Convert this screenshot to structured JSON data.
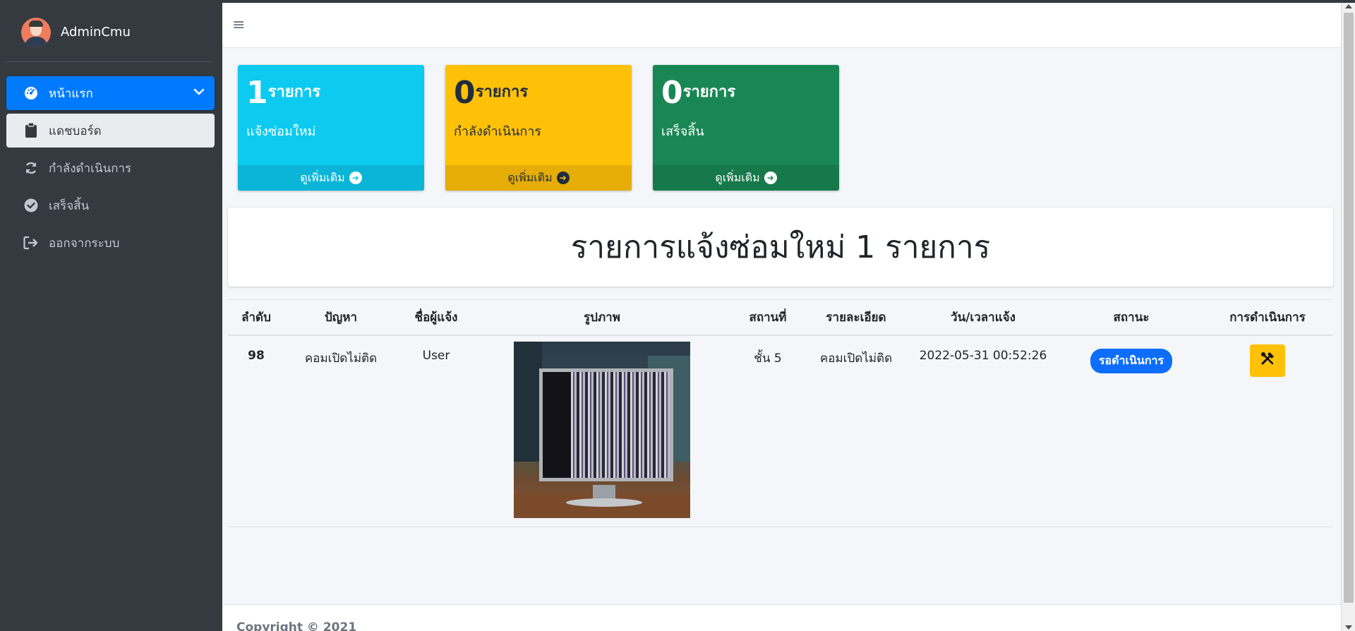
{
  "brand": {
    "name": "AdminCmu"
  },
  "sidebar": {
    "items": [
      {
        "label": "หน้าแรก",
        "icon": "tachometer-icon"
      },
      {
        "label": "แดชบอร์ด",
        "icon": "clipboard-icon"
      },
      {
        "label": "กำลังดำเนินการ",
        "icon": "sync-icon"
      },
      {
        "label": "เสร็จสิ้น",
        "icon": "check-circle-icon"
      },
      {
        "label": "ออกจากระบบ",
        "icon": "sign-out-icon"
      }
    ]
  },
  "boxes": [
    {
      "count": "1",
      "unit": "รายการ",
      "label": "แจ้งซ่อมใหม่",
      "more": "ดูเพิ่มเติม",
      "color": "#0dcaf0"
    },
    {
      "count": "0",
      "unit": "รายการ",
      "label": "กำลังดำเนินการ",
      "more": "ดูเพิ่มเติม",
      "color": "#ffc107"
    },
    {
      "count": "0",
      "unit": "รายการ",
      "label": "เสร็จสิ้น",
      "more": "ดูเพิ่มเติม",
      "color": "#198754"
    }
  ],
  "title": "รายการแจ้งซ่อมใหม่ 1 รายการ",
  "table": {
    "headers": [
      "ลำดับ",
      "ปัญหา",
      "ชื่อผู้แจ้ง",
      "รูปภาพ",
      "สถานที่",
      "รายละเอียด",
      "วัน/เวลาแจ้ง",
      "สถานะ",
      "การดำเนินการ"
    ],
    "rows": [
      {
        "no": "98",
        "problem": "คอมเปิดไม่ติด",
        "reporter": "User",
        "location": "ชั้น 5",
        "detail": "คอมเปิดไม่ติด",
        "datetime": "2022-05-31 00:52:26",
        "status": "รอดำเนินการ"
      }
    ]
  },
  "footer": {
    "copyright": "Copyright © 2021"
  },
  "colors": {
    "sidebar_bg": "#343a40",
    "active": "#007bff",
    "info": "#0dcaf0",
    "warning": "#ffc107",
    "success": "#198754",
    "badge": "#0d6efd"
  }
}
